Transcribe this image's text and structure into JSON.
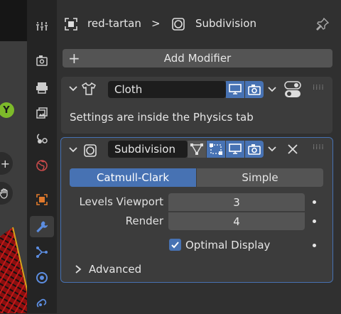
{
  "viewport": {
    "axis_label": "Y"
  },
  "header": {
    "object_name": "red-tartan",
    "separator": ">",
    "modifier_name": "Subdivision"
  },
  "toolbar": {
    "add_modifier_label": "Add Modifier",
    "add_icon": "+"
  },
  "cloth_modifier": {
    "name": "Cloth",
    "info_text": "Settings are inside the Physics tab"
  },
  "subdivision_modifier": {
    "name": "Subdivision",
    "mode_options": [
      "Catmull-Clark",
      "Simple"
    ],
    "selected_mode": "Catmull-Clark",
    "levels_viewport_label": "Levels Viewport",
    "levels_viewport_value": "3",
    "render_label": "Render",
    "render_value": "4",
    "optimal_display_label": "Optimal Display",
    "optimal_display_checked": true,
    "advanced_label": "Advanced"
  },
  "colors": {
    "accent": "#4772b3",
    "panel": "#3c3c3c",
    "field": "#545454"
  }
}
